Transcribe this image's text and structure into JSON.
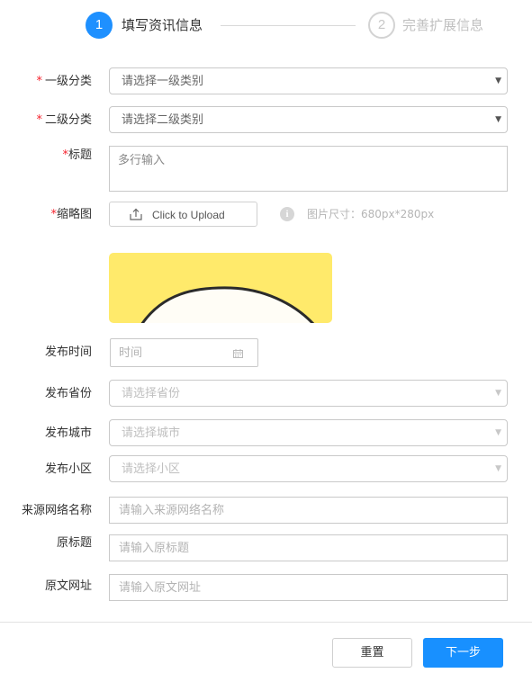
{
  "steps": [
    {
      "number": "1",
      "label": "填写资讯信息"
    },
    {
      "number": "2",
      "label": "完善扩展信息"
    }
  ],
  "form": {
    "category1": {
      "label": "一级分类",
      "required_mark": "*",
      "placeholder": "请选择一级类别"
    },
    "category2": {
      "label": "二级分类",
      "required_mark": "*",
      "placeholder": "请选择二级类别"
    },
    "title": {
      "label": "标题",
      "required_mark": "*",
      "placeholder": "多行输入"
    },
    "thumbnail": {
      "label": "缩略图",
      "required_mark": "*",
      "upload_label": "Click to Upload",
      "hint": "图片尺寸：680px*280px"
    },
    "publish_time": {
      "label": "发布时间",
      "placeholder": "时间"
    },
    "province": {
      "label": "发布省份",
      "placeholder": "请选择省份"
    },
    "city": {
      "label": "发布城市",
      "placeholder": "请选择城市"
    },
    "district": {
      "label": "发布小区",
      "placeholder": "请选择小区"
    },
    "source_name": {
      "label": "来源网络名称",
      "placeholder": "请输入来源网络名称"
    },
    "original_title": {
      "label": "原标题",
      "placeholder": "请输入原标题"
    },
    "original_url": {
      "label": "原文网址",
      "placeholder": "请输入原文网址"
    }
  },
  "buttons": {
    "reset": "重置",
    "next": "下一步"
  },
  "colors": {
    "primary": "#1890ff",
    "required": "#f5222d",
    "thumbnail_bg": "#ffea6b"
  },
  "icons": {
    "upload": "upload-icon",
    "info": "info-icon",
    "calendar": "calendar-icon",
    "dropdown": "chevron-down-icon"
  }
}
